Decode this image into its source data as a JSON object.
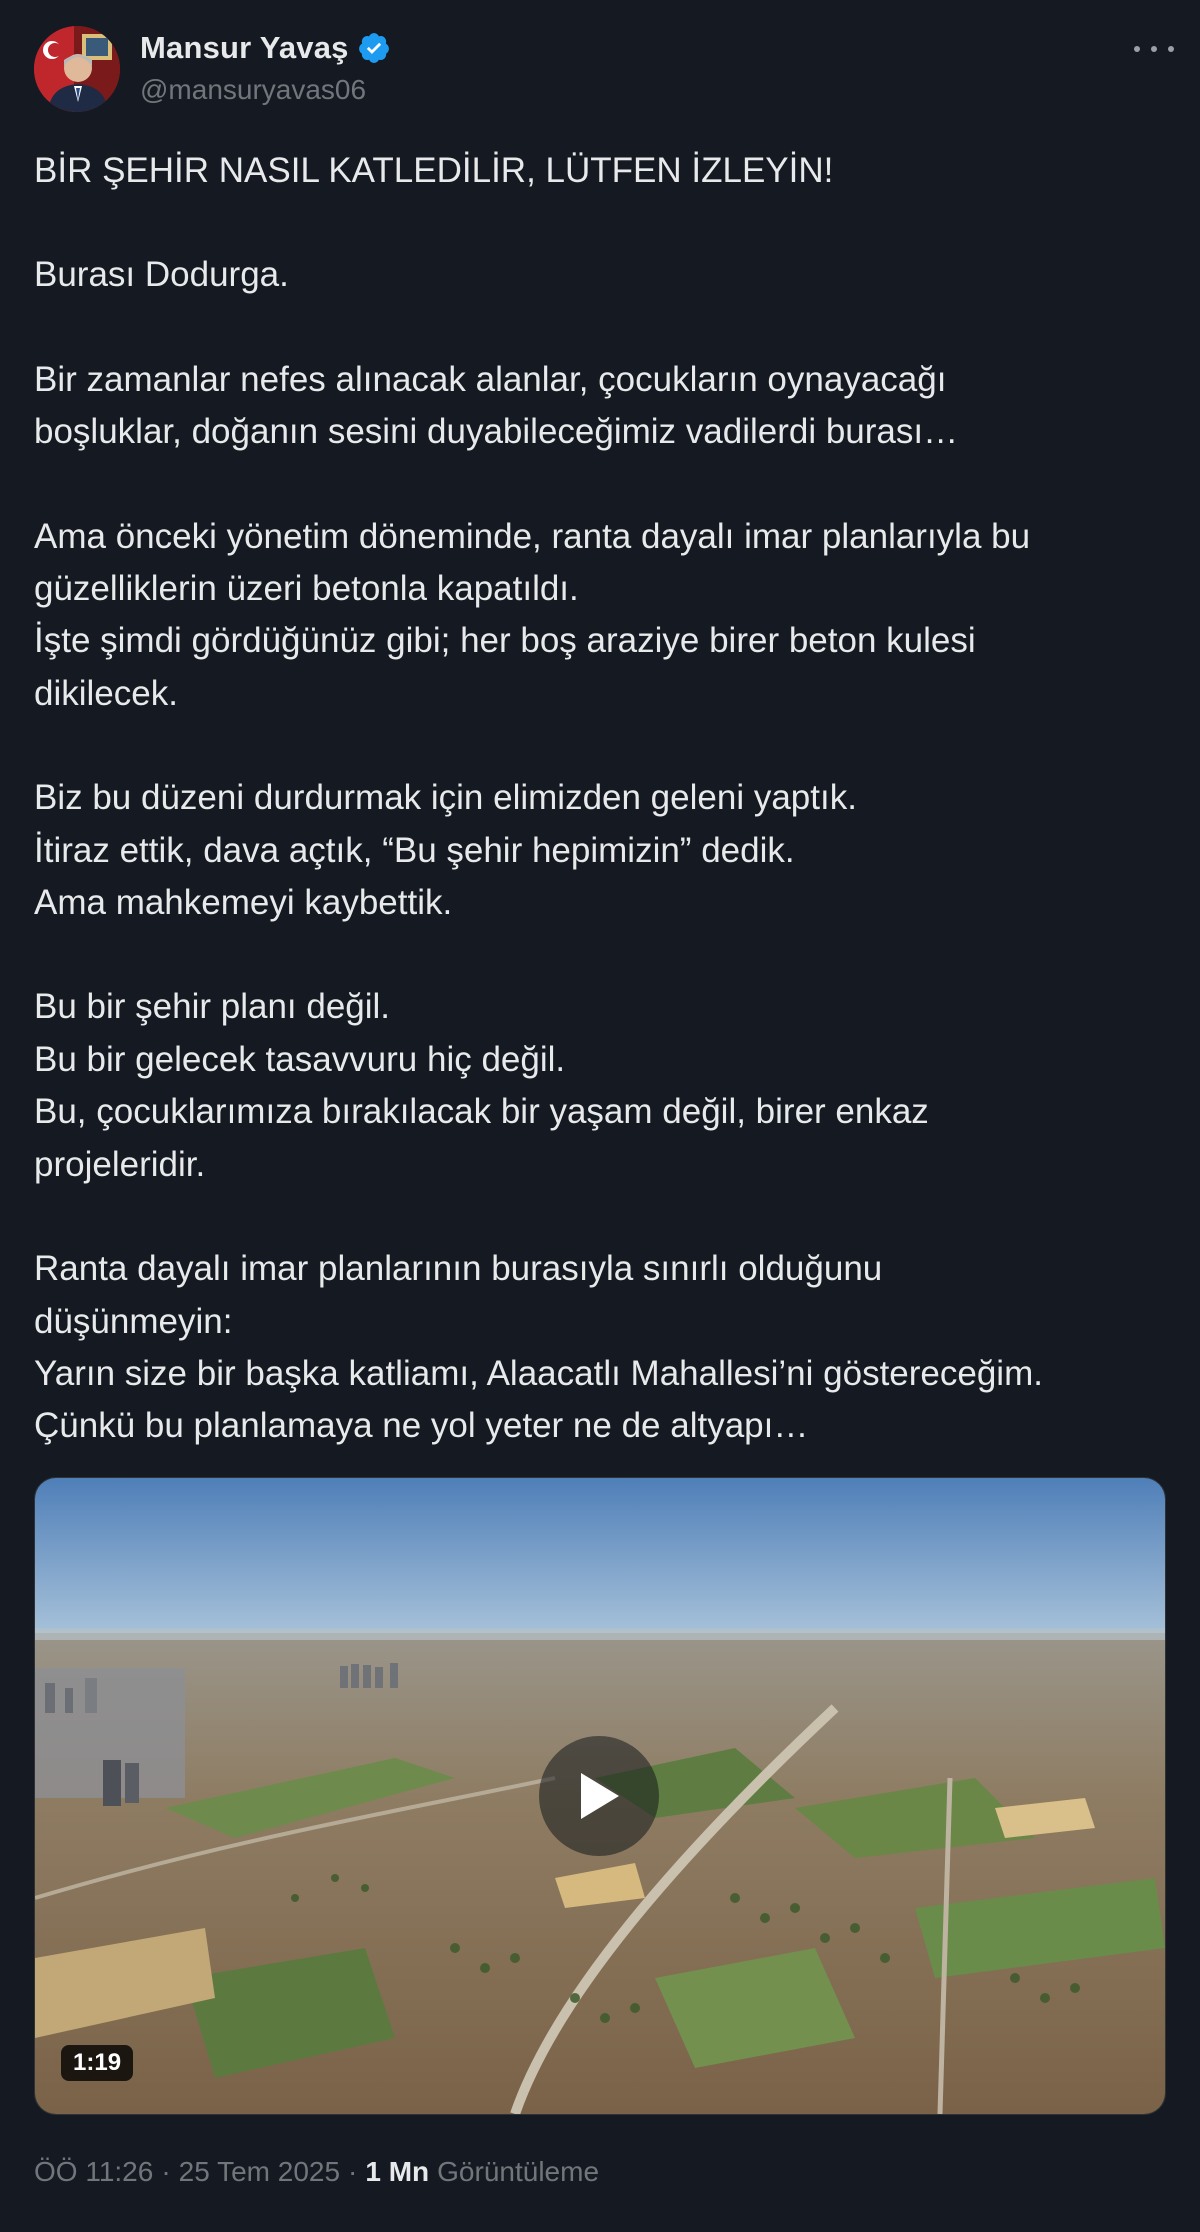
{
  "author": {
    "display_name": "Mansur Yavaş",
    "handle": "@mansuryavas06",
    "verified": true
  },
  "tweet": {
    "paragraphs": [
      [
        "BİR ŞEHİR NASIL KATLEDİLİR, LÜTFEN İZLEYİN!"
      ],
      [
        "Burası Dodurga."
      ],
      [
        "Bir zamanlar nefes alınacak alanlar, çocukların oynayacağı",
        "boşluklar, doğanın sesini duyabileceğimiz vadilerdi burası…"
      ],
      [
        "Ama önceki yönetim döneminde, ranta dayalı imar planlarıyla bu",
        "güzelliklerin üzeri betonla kapatıldı.",
        "İşte şimdi gördüğünüz gibi; her boş araziye birer beton kulesi",
        "dikilecek."
      ],
      [
        "Biz bu düzeni durdurmak için elimizden geleni yaptık.",
        "İtiraz ettik, dava açtık, “Bu şehir hepimizin” dedik.",
        "Ama mahkemeyi kaybettik."
      ],
      [
        "Bu bir şehir planı değil.",
        "Bu bir gelecek tasavvuru hiç değil.",
        "Bu, çocuklarımıza bırakılacak bir yaşam değil, birer enkaz",
        "projeleridir."
      ],
      [
        "Ranta dayalı imar planlarının burasıyla sınırlı olduğunu",
        "düşünmeyin:",
        "Yarın size bir başka katliamı, Alaacatlı Mahallesi’ni göstereceğim.",
        "Çünkü bu planlamaya ne yol yeter ne de altyapı…"
      ]
    ]
  },
  "media": {
    "type": "video",
    "duration": "1:19",
    "description_icon": "play-icon"
  },
  "meta": {
    "time": "ÖÖ 11:26",
    "separator": "·",
    "date": "25 Tem 2025",
    "views_count": "1 Mn",
    "views_label": "Görüntüleme"
  },
  "colors": {
    "background": "#151a22",
    "text": "#e7e9ea",
    "secondary": "#71767b",
    "verified": "#1d9bf0"
  },
  "icons": {
    "verified": "verified-badge-icon",
    "more": "more-dots-icon",
    "play": "play-icon"
  }
}
